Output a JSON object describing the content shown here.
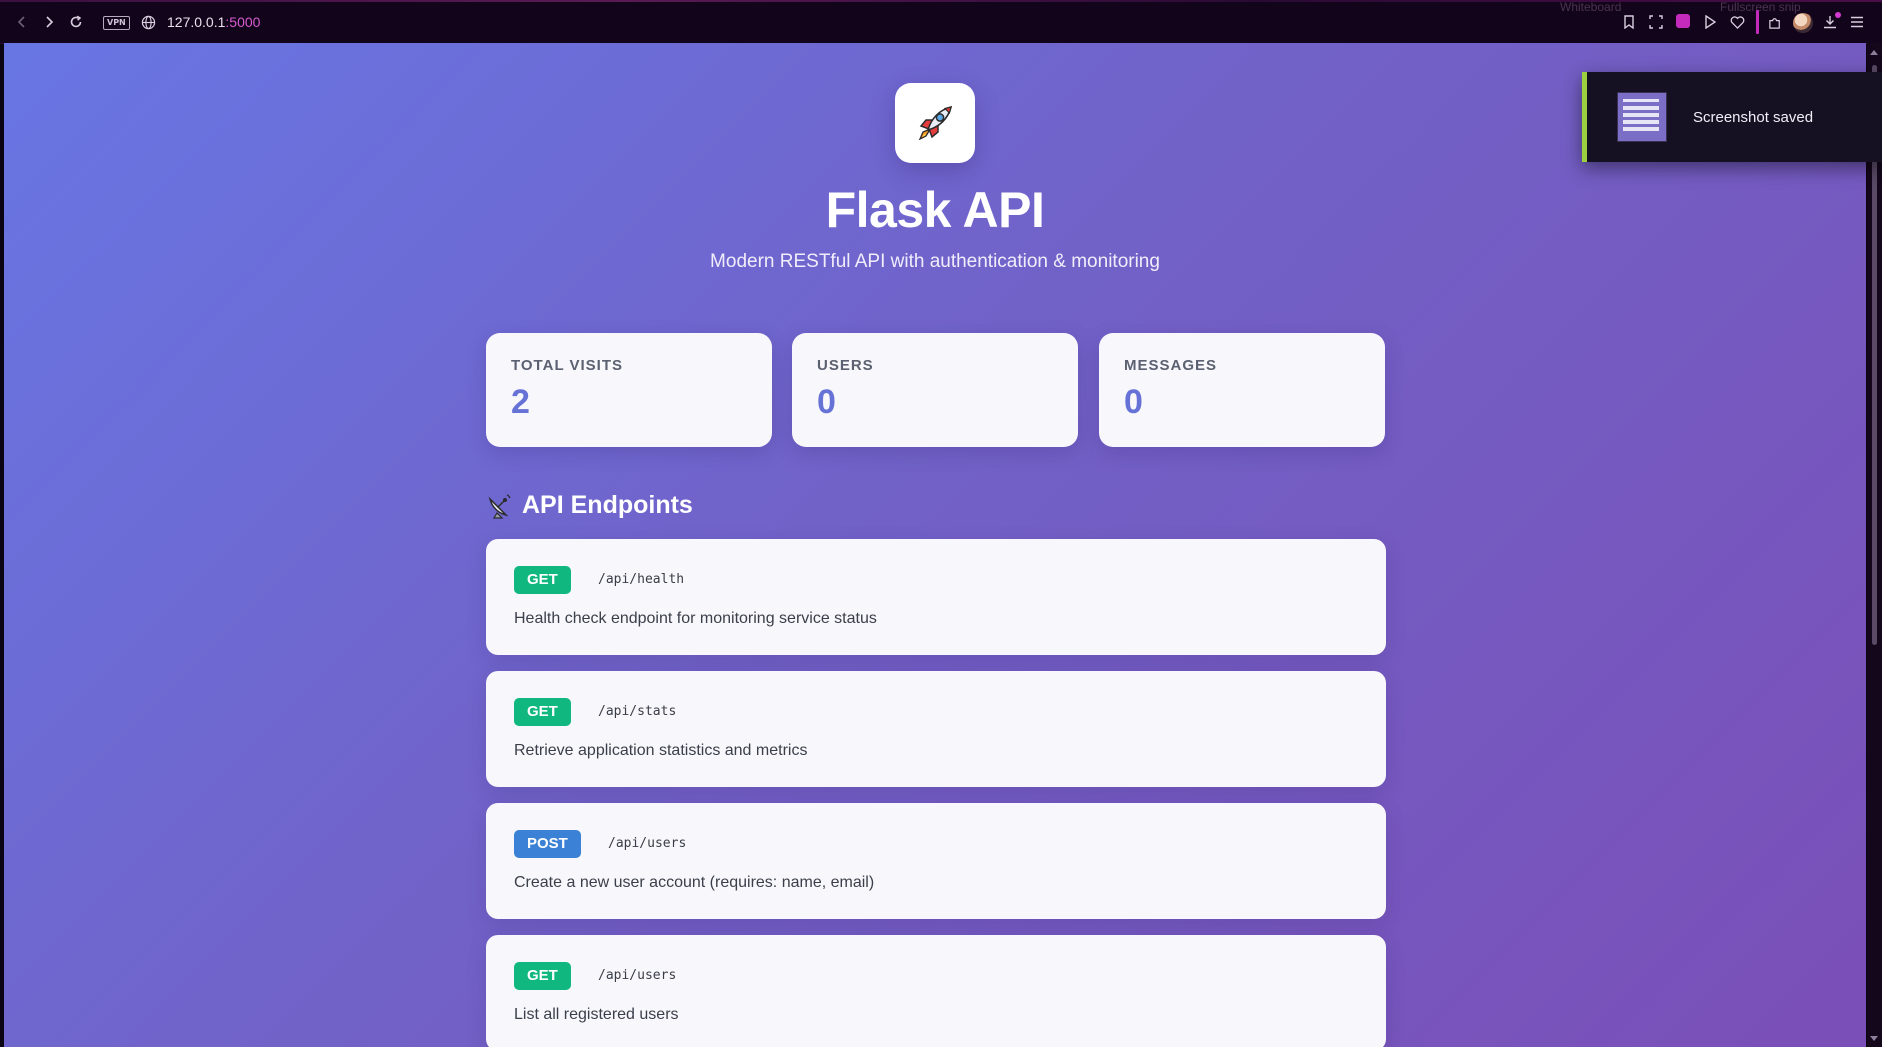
{
  "browser": {
    "url_host": "127.0.0.1",
    "url_port": ":5000",
    "vpn_label": "VPN",
    "ghost_tabs": [
      "Whiteboard",
      "Fullscreen snip"
    ]
  },
  "hero": {
    "logo_icon": "rocket-icon",
    "title": "Flask API",
    "subtitle": "Modern RESTful API with authentication & monitoring"
  },
  "stats": [
    {
      "label": "TOTAL VISITS",
      "value": "2"
    },
    {
      "label": "USERS",
      "value": "0"
    },
    {
      "label": "MESSAGES",
      "value": "0"
    }
  ],
  "endpoints_section": {
    "icon": "satellite-dish-icon",
    "title": "API Endpoints"
  },
  "endpoints": [
    {
      "method": "GET",
      "path": "/api/health",
      "description": "Health check endpoint for monitoring service status"
    },
    {
      "method": "GET",
      "path": "/api/stats",
      "description": "Retrieve application statistics and metrics"
    },
    {
      "method": "POST",
      "path": "/api/users",
      "description": "Create a new user account (requires: name, email)"
    },
    {
      "method": "GET",
      "path": "/api/users",
      "description": "List all registered users"
    }
  ],
  "toast": {
    "message": "Screenshot saved"
  },
  "colors": {
    "get": "#10b77f",
    "post": "#3b82d6",
    "stat_value": "#6672d6",
    "gradient_start": "#6876e4",
    "gradient_end": "#7a4fb7",
    "toast_accent": "#9bd13e"
  }
}
